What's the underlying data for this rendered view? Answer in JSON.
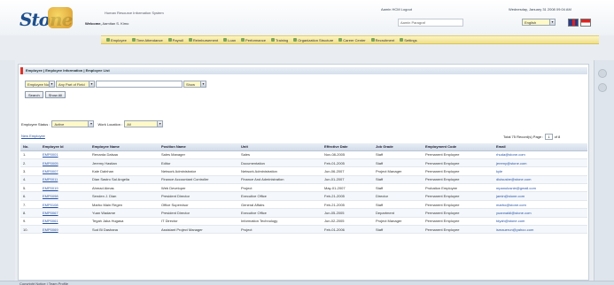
{
  "header": {
    "logo_text": "Stone",
    "tagline": "Human Resource Information System",
    "welcome_label": "Welcome,",
    "welcome_user": "Aamitan S. Kimo",
    "user_info": "Aamin HCM Logout",
    "date_text": "Wednesday, January 31 2008 09:04 AM",
    "search_placeholder": "Aamin Paragraf",
    "language": "English"
  },
  "menu": [
    "Employee",
    "Time Attendance",
    "Payroll",
    "Reimbursement",
    "Loan",
    "Performance",
    "Training",
    "Organization Structure",
    "Career Center",
    "Recruitment",
    "Settings"
  ],
  "breadcrumb": "Employee | Employee Information | Employee List",
  "filter": {
    "field1": "Employee No",
    "field2": "Any Part of Field",
    "field3": "Show"
  },
  "buttons": {
    "search": "Search",
    "show_all": "Show All"
  },
  "status_filter": {
    "label": "Employee Status :",
    "value": "Active",
    "work_location_label": "Work Location :",
    "work_location_value": "All"
  },
  "new_link": "New Employee",
  "pagination": {
    "label": "Total 75 Record(s) Page :",
    "page": "1",
    "of": "of 8"
  },
  "table": {
    "columns": [
      "No.",
      "Employee Id",
      "Employee Name",
      "Position Name",
      "Unit",
      "Effective Date",
      "Job Grade",
      "Employment Code",
      "Email"
    ],
    "rows": [
      [
        "1.",
        "EMP0001",
        "Renarda Dalsaa",
        "Sales Manager",
        "Sales",
        "Nov-08-2005",
        "Staff",
        "Permanent Employee",
        "rhuda@stone.com"
      ],
      [
        "2.",
        "EMP0005",
        "Jeremy Hastian",
        "Editor",
        "Documentation",
        "Feb-01-2005",
        "Staff",
        "Permanent Employee",
        "jeremy@stone.com"
      ],
      [
        "3.",
        "EMP0007",
        "Kale Dalnhan",
        "Network Administrator",
        "Network Administration",
        "Jun-06-2007",
        "Project Manager",
        "Permanent Employee",
        "kyle"
      ],
      [
        "4.",
        "EMP0011",
        "Dian Sastro Sal Angelia",
        "Finance Accountant Controller",
        "Finance And Administration",
        "Jun-01-2007",
        "Staff",
        "Permanent Employee",
        "dluisusbe@stone.com"
      ],
      [
        "5.",
        "EMP0019",
        "Ahmad Aimas",
        "Web Developer",
        "Project",
        "May-01-2007",
        "Staff",
        "Probation Employee",
        "mpanulusnie@gmail.com"
      ],
      [
        "6.",
        "EMP0098",
        "Senden J. Dian",
        "President Director",
        "Executive Office",
        "Feb-21-2005",
        "Director",
        "Permanent Employee",
        "jamin@stone.com"
      ],
      [
        "7.",
        "EMP0108",
        "Marbo Main Regen",
        "Office Supervisor",
        "General Affairs",
        "Feb-21-2005",
        "Staff",
        "Permanent Employee",
        "marbo@stone.com"
      ],
      [
        "8.",
        "EMP0067",
        "Yuan Wadame",
        "President Director",
        "Executive Office",
        "Jun-05-2005",
        "Department",
        "Permanent Employee",
        "yuannaldi@stone.com"
      ],
      [
        "9.",
        "EMP0061",
        "Tegah Jaka Hugasa",
        "IT Director",
        "Information Technology",
        "Jun-02-2005",
        "Project Manager",
        "Permanent Employee",
        "tdyah@stone.com"
      ],
      [
        "10.",
        "EMP0069",
        "Sud Bi Dashana",
        "Assistant Project Manager",
        "Project",
        "Feb-01-2006",
        "Staff",
        "Permanent Employee",
        "ismauerun@yahoo.com"
      ]
    ]
  },
  "footer": "Copyright Notice | Team Profile"
}
